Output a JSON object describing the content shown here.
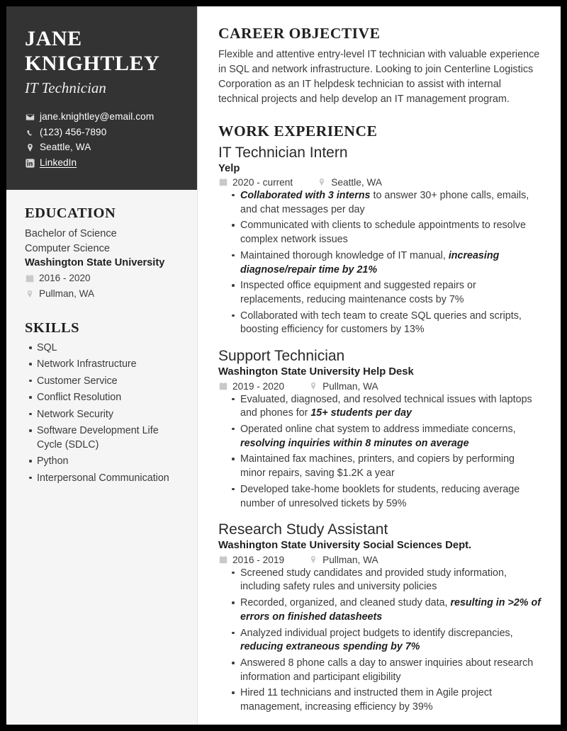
{
  "colors": {
    "page_border": "#000000",
    "sidebar_dark": "#333333",
    "sidebar_light": "#f5f5f5",
    "heading": "#1f1f1f",
    "body_text": "#3b3b3b",
    "icon_gray": "#c9c9c9"
  },
  "sidebar": {
    "name_line1": "JANE",
    "name_line2": "KNIGHTLEY",
    "role": "IT Technician",
    "contacts": [
      {
        "icon": "envelope-icon",
        "text": "jane.knightley@email.com",
        "link": false
      },
      {
        "icon": "phone-icon",
        "text": "(123) 456-7890",
        "link": false
      },
      {
        "icon": "location-pin-icon",
        "text": "Seattle, WA",
        "link": false
      },
      {
        "icon": "linkedin-icon",
        "text": "LinkedIn",
        "link": true
      }
    ],
    "education": {
      "heading": "EDUCATION",
      "degree": "Bachelor of Science",
      "major": "Computer Science",
      "school": "Washington State University",
      "dates": "2016 - 2020",
      "location": "Pullman, WA"
    },
    "skills": {
      "heading": "SKILLS",
      "items": [
        "SQL",
        "Network Infrastructure",
        "Customer Service",
        "Conflict Resolution",
        "Network Security",
        "Software Development Life Cycle (SDLC)",
        "Python",
        "Interpersonal Communication"
      ]
    }
  },
  "main": {
    "objective": {
      "heading": "CAREER OBJECTIVE",
      "text": "Flexible and attentive entry-level IT technician with valuable experience in SQL and network infrastructure. Looking to join Centerline Logistics Corporation as an IT helpdesk technician to assist with internal technical projects and help develop an IT management program."
    },
    "work_experience": {
      "heading": "WORK EXPERIENCE",
      "jobs": [
        {
          "title": "IT Technician Intern",
          "company": "Yelp",
          "dates": "2020 - current",
          "location": "Seattle, WA",
          "bullets": [
            {
              "pre": "",
              "em": "Collaborated with 3 interns",
              "post": " to answer 30+ phone calls, emails, and chat messages per day"
            },
            {
              "pre": "Communicated with clients to schedule appointments to resolve complex network issues",
              "em": "",
              "post": ""
            },
            {
              "pre": "Maintained thorough knowledge of IT manual, ",
              "em": "increasing diagnose/repair time by 21%",
              "post": ""
            },
            {
              "pre": "Inspected office equipment and suggested repairs or replacements, reducing maintenance costs by 7%",
              "em": "",
              "post": ""
            },
            {
              "pre": "Collaborated with tech team to create SQL queries and scripts, boosting efficiency for customers by 13%",
              "em": "",
              "post": ""
            }
          ]
        },
        {
          "title": "Support Technician",
          "company": "Washington State University Help Desk",
          "dates": "2019 - 2020",
          "location": "Pullman, WA",
          "bullets": [
            {
              "pre": "Evaluated, diagnosed, and resolved technical issues with laptops and phones for ",
              "em": "15+ students per day",
              "post": ""
            },
            {
              "pre": "Operated online chat system to address immediate concerns, ",
              "em": "resolving inquiries within 8 minutes on average",
              "post": ""
            },
            {
              "pre": "Maintained fax machines, printers, and copiers by performing minor repairs, saving $1.2K a year",
              "em": "",
              "post": ""
            },
            {
              "pre": "Developed take-home booklets for students, reducing average number of unresolved tickets by 59%",
              "em": "",
              "post": ""
            }
          ]
        },
        {
          "title": "Research Study Assistant",
          "company": "Washington State University Social Sciences Dept.",
          "dates": "2016 - 2019",
          "location": "Pullman, WA",
          "bullets": [
            {
              "pre": "Screened study candidates and provided study information, including safety rules and university policies",
              "em": "",
              "post": ""
            },
            {
              "pre": "Recorded, organized, and cleaned study data, ",
              "em": "resulting in >2% of errors on finished datasheets",
              "post": ""
            },
            {
              "pre": "Analyzed individual project budgets to identify discrepancies, ",
              "em": "reducing extraneous spending by 7%",
              "post": ""
            },
            {
              "pre": "Answered 8 phone calls a day to answer inquiries about research information and participant eligibility",
              "em": "",
              "post": ""
            },
            {
              "pre": "Hired 11 technicians and instructed them in Agile project management, increasing efficiency by 39%",
              "em": "",
              "post": ""
            }
          ]
        }
      ]
    }
  }
}
